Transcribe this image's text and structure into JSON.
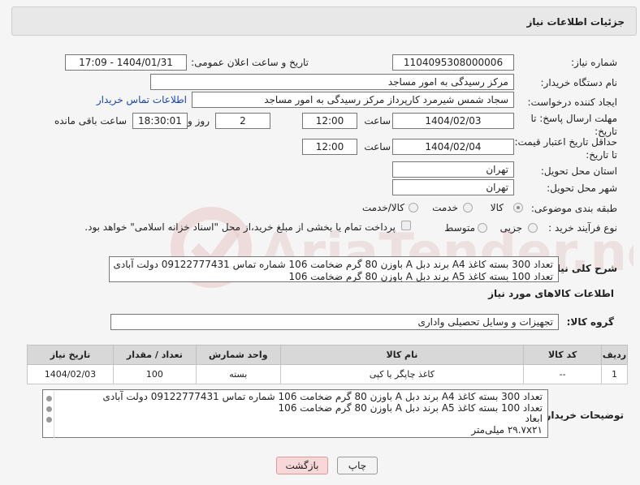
{
  "header": {
    "title": "جزئیات اطلاعات نیاز"
  },
  "fields": {
    "need_number_label": "شماره نیاز:",
    "need_number": "1104095308000006",
    "announce_label": "تاریخ و ساعت اعلان عمومی:",
    "announce_value": "1404/01/31 - 17:09",
    "buyer_org_label": "نام دستگاه خریدار:",
    "buyer_org": "مرکز رسیدگی به امور مساجد",
    "requester_label": "ایجاد کننده درخواست:",
    "requester": "سجاد شمس شیرمرد کارپرداز مرکز رسیدگی به امور مساجد",
    "buyer_contact_link": "اطلاعات تماس خریدار",
    "reply_deadline_label": "مهلت ارسال پاسخ: تا تاریخ:",
    "reply_date": "1404/02/03",
    "time_word": "ساعت",
    "reply_time": "12:00",
    "days_value": "2",
    "days_word": "روز و",
    "remaining_time": "18:30:01",
    "remaining_word": "ساعت باقی مانده",
    "price_validity_label": "حداقل تاریخ اعتبار قیمت: تا تاریخ:",
    "price_date": "1404/02/04",
    "price_time": "12:00",
    "province_label": "استان محل تحویل:",
    "province": "تهران",
    "city_label": "شهر محل تحویل:",
    "city": "تهران",
    "category_label": "طبقه بندی موضوعی:",
    "category_options": [
      "کالا",
      "خدمت",
      "کالا/خدمت"
    ],
    "process_label": "نوع فرآیند خرید :",
    "process_options": [
      "جزیی",
      "متوسط"
    ],
    "payment_note": "پرداخت تمام یا بخشی از مبلغ خرید،از محل \"اسناد خزانه اسلامی\" خواهد بود.",
    "description_label": "شرح کلی نیاز:",
    "description_lines": [
      "تعداد 300 بسته کاغذ A4 برند دبل A باوزن 80 گرم ضخامت 106 شماره تماس 09122777431 دولت آبادی",
      "تعداد 100 بسته کاغذ A5 برند دبل A باوزن 80 گرم ضخامت 106"
    ],
    "goods_info_title": "اطلاعات کالاهای مورد نیاز",
    "goods_group_label": "گروه کالا:",
    "goods_group": "تجهیزات و وسایل تحصیلی واداری"
  },
  "table": {
    "headers": [
      "ردیف",
      "کد کالا",
      "نام کالا",
      "واحد شمارش",
      "تعداد / مقدار",
      "تاریخ نیاز"
    ],
    "rows": [
      [
        "1",
        "--",
        "کاغذ چاپگر یا کپی",
        "بسته",
        "100",
        "1404/02/03"
      ]
    ]
  },
  "buyer_notes": {
    "label": "توضیحات خریدار:",
    "lines": [
      "تعداد 300 بسته کاغذ A4 برند دبل A باوزن 80 گرم ضخامت 106 شماره تماس 09122777431 دولت آبادی",
      "تعداد 100 بسته کاغذ A5 برند دبل A باوزن 80 گرم ضخامت 106",
      "ابعاد",
      "۲۹.۷x۲۱ میلی‌متر"
    ]
  },
  "buttons": {
    "print": "چاپ",
    "back": "بازگشت"
  },
  "watermark": "AriaTender.neT",
  "colors": {
    "link": "#1a47b0",
    "back_button_bg": "#f7d7d7",
    "header_bg": "#e8e8e8"
  }
}
